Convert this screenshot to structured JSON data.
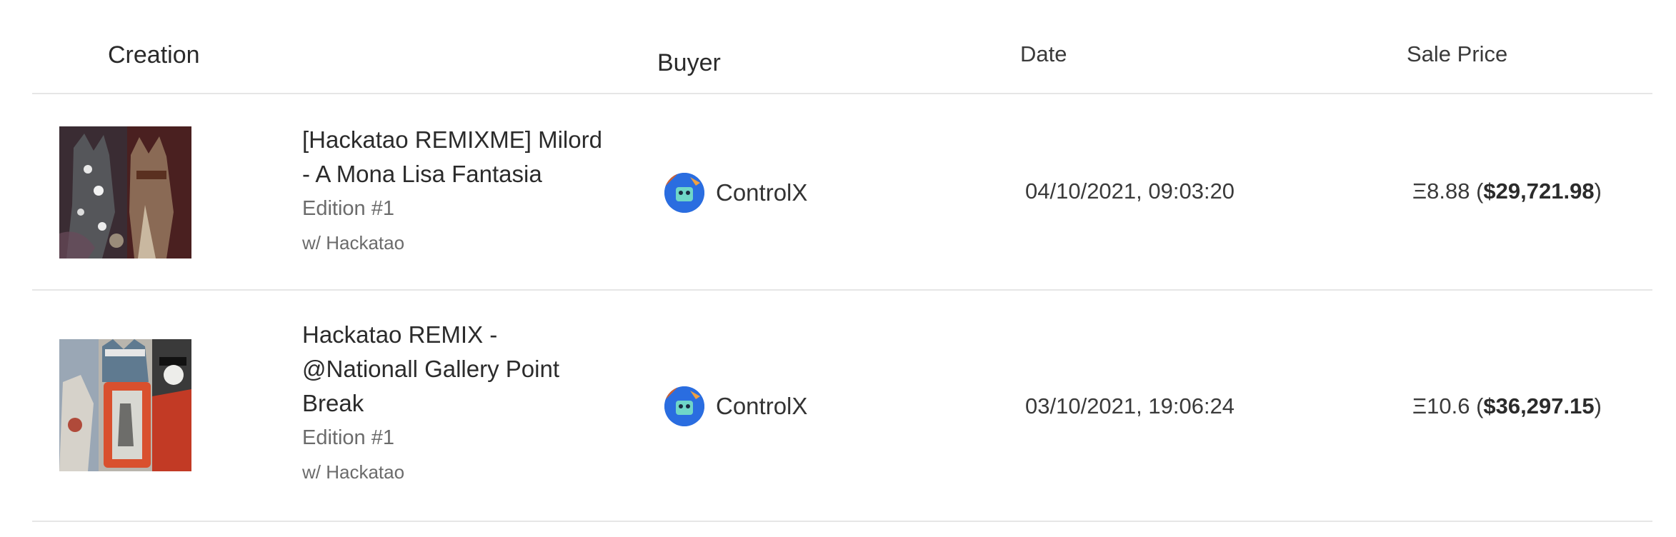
{
  "table": {
    "headers": {
      "creation": "Creation",
      "buyer": "Buyer",
      "date": "Date",
      "sale_price": "Sale Price"
    },
    "rows": [
      {
        "title_line1": "[Hackatao REMIXME] Milord",
        "title_line2": "- A Mona Lisa Fantasia",
        "edition": "Edition #1",
        "collab": "w/ Hackatao",
        "buyer": "ControlX",
        "date": "04/10/2021, 09:03:20",
        "eth": "Ξ8.88",
        "usd": "$29,721.98",
        "thumbnail": "hackatao-milord-artwork"
      },
      {
        "title_line1": "Hackatao REMIX -",
        "title_line2": "@Nationall Gallery Point",
        "title_line3": "Break",
        "edition": "Edition #1",
        "collab": "w/ Hackatao",
        "buyer": "ControlX",
        "date": "03/10/2021, 19:06:24",
        "eth": "Ξ10.6",
        "usd": "$36,297.15",
        "thumbnail": "hackatao-remix-artwork"
      }
    ]
  },
  "colors": {
    "divider": "#e6e6e6",
    "text": "#2b2b2b",
    "muted": "#6b6b6b"
  }
}
